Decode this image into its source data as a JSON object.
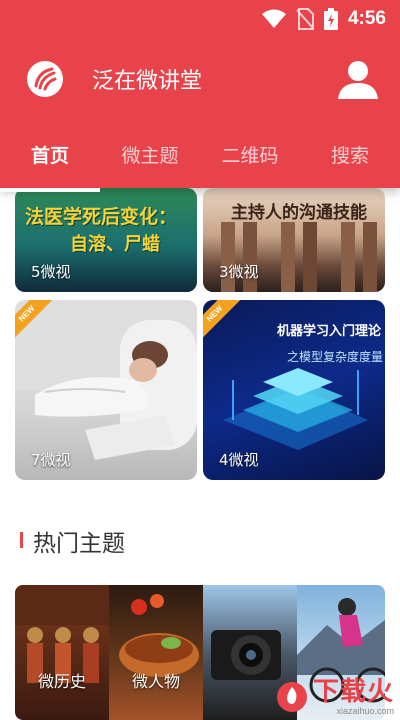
{
  "status_bar": {
    "time": "4:56"
  },
  "app_bar": {
    "title": "泛在微讲堂"
  },
  "tabs": [
    {
      "label": "首页",
      "active": true
    },
    {
      "label": "微主题",
      "active": false
    },
    {
      "label": "二维码",
      "active": false
    },
    {
      "label": "搜索",
      "active": false
    }
  ],
  "videos": [
    {
      "title_line1": "法医学死后变化：",
      "title_line2": "自溶、尸蜡",
      "count": "5微视"
    },
    {
      "title_line1": "主持人的沟通技能",
      "count": "3微视"
    },
    {
      "badge": "NEW",
      "count": "7微视"
    },
    {
      "badge": "NEW",
      "title_line1": "机器学习入门理论",
      "title_line2": "之模型复杂度度量",
      "count": "4微视"
    }
  ],
  "section": {
    "title": "热门主题"
  },
  "themes": [
    {
      "label": "微历史"
    },
    {
      "label": "微人物"
    },
    {
      "label": ""
    },
    {
      "label": ""
    }
  ],
  "watermark": {
    "text": "下载火",
    "url": "xiazaihuo.com"
  },
  "colors": {
    "primary": "#e8434a",
    "badge": "#f4a21e"
  }
}
